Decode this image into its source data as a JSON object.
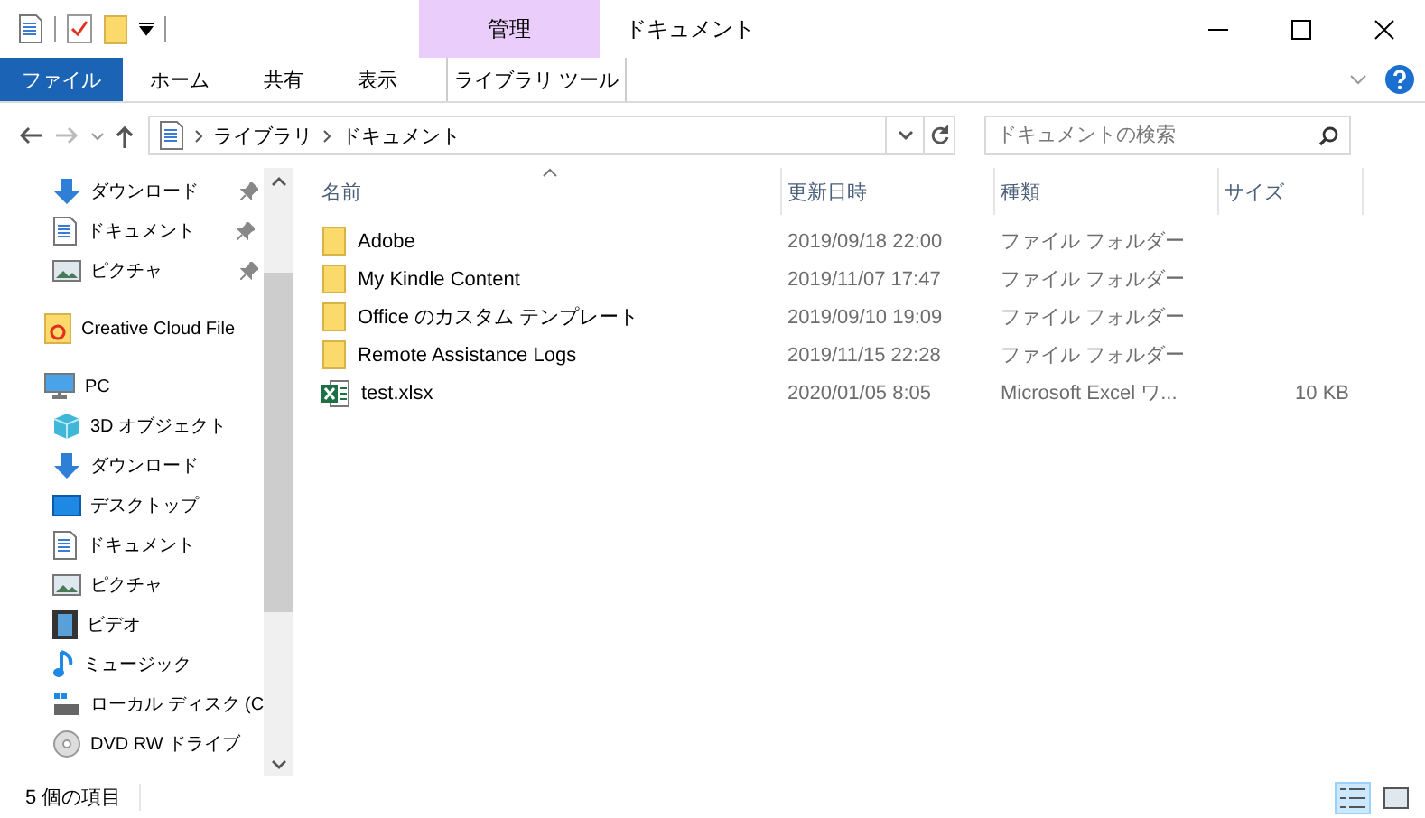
{
  "window": {
    "title": "ドキュメント",
    "context_tab": "管理"
  },
  "ribbon_tabs": [
    {
      "label": "ファイル",
      "selected": true,
      "kind": "file"
    },
    {
      "label": "ホーム",
      "selected": false,
      "kind": "normal"
    },
    {
      "label": "共有",
      "selected": false,
      "kind": "normal"
    },
    {
      "label": "表示",
      "selected": false,
      "kind": "normal"
    },
    {
      "label": "ライブラリ ツール",
      "selected": false,
      "kind": "context"
    }
  ],
  "address": {
    "path": [
      "ライブラリ",
      "ドキュメント"
    ]
  },
  "search": {
    "placeholder": "ドキュメントの検索"
  },
  "nav": [
    {
      "label": "ダウンロード",
      "kind": "pinned"
    },
    {
      "label": "ドキュメント",
      "kind": "pinned"
    },
    {
      "label": "ピクチャ",
      "kind": "pinned"
    },
    {
      "label": "Creative Cloud File",
      "kind": "root"
    },
    {
      "label": "PC",
      "kind": "root"
    },
    {
      "label": "3D オブジェクト",
      "kind": "child"
    },
    {
      "label": "ダウンロード",
      "kind": "child"
    },
    {
      "label": "デスクトップ",
      "kind": "child"
    },
    {
      "label": "ドキュメント",
      "kind": "child"
    },
    {
      "label": "ピクチャ",
      "kind": "child"
    },
    {
      "label": "ビデオ",
      "kind": "child"
    },
    {
      "label": "ミュージック",
      "kind": "child"
    },
    {
      "label": "ローカル ディスク (C",
      "kind": "child"
    },
    {
      "label": "DVD RW ドライブ",
      "kind": "child"
    }
  ],
  "columns": [
    "名前",
    "更新日時",
    "種類",
    "サイズ"
  ],
  "files": [
    {
      "name": "Adobe",
      "date": "2019/09/18 22:00",
      "type": "ファイル フォルダー",
      "kind": "folder"
    },
    {
      "name": "My Kindle Content",
      "date": "2019/11/07 17:47",
      "type": "ファイル フォルダー",
      "kind": "folder"
    },
    {
      "name": "Office のカスタム テンプレート",
      "date": "2019/09/10 19:09",
      "type": "ファイル フォルダー",
      "kind": "folder"
    },
    {
      "name": "Remote Assistance Logs",
      "date": "2019/11/15 22:28",
      "type": "ファイル フォルダー",
      "kind": "folder"
    },
    {
      "name": "test.xlsx",
      "date": "2020/01/05 8:05",
      "type": "Microsoft Excel ワ...",
      "size": "10 KB",
      "kind": "excel"
    }
  ],
  "status_bar": {
    "count": "5 個の項目"
  }
}
